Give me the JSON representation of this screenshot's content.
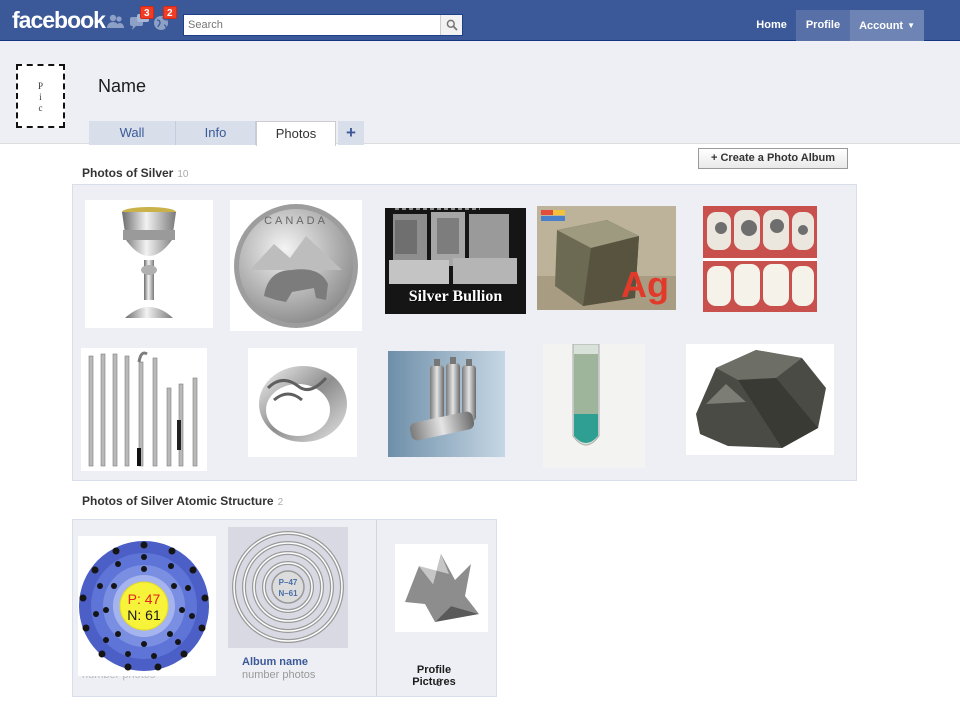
{
  "topbar": {
    "logo": "facebook",
    "search_placeholder": "Search",
    "notifications": [
      {
        "icon": "friend-requests-icon",
        "count": ""
      },
      {
        "icon": "messages-icon",
        "count": "3"
      },
      {
        "icon": "notifications-globe-icon",
        "count": "2"
      }
    ],
    "nav": [
      {
        "label": "Home"
      },
      {
        "label": "Profile"
      },
      {
        "label": "Account"
      }
    ],
    "colors": {
      "bar": "#3b5998",
      "badge": "#f03d25"
    }
  },
  "profile": {
    "pic_letters": [
      "P",
      "i",
      "c"
    ],
    "name": "Name",
    "tabs": [
      {
        "label": "Wall"
      },
      {
        "label": "Info"
      },
      {
        "label": "Photos"
      }
    ],
    "active_tab": "Photos",
    "add_tab_symbol": "+"
  },
  "photos": {
    "create_album_label": "+ Create a Photo Album",
    "album1": {
      "title": "Photos of Silver",
      "count": "10",
      "items": [
        {
          "name": "silver-goblet"
        },
        {
          "name": "canada-silver-coin"
        },
        {
          "name": "silver-bullion-bars",
          "caption": "Silver Bullion"
        },
        {
          "name": "silver-element-cube",
          "caption": "Ag"
        },
        {
          "name": "dental-fillings"
        },
        {
          "name": "silver-flutes"
        },
        {
          "name": "silver-ring"
        },
        {
          "name": "silver-batteries"
        },
        {
          "name": "silver-test-tube"
        },
        {
          "name": "silver-ore-rock"
        }
      ]
    },
    "album2": {
      "title": "Photos of Silver Atomic Structure",
      "count": "2",
      "diagram_p": "P: 47",
      "diagram_n": "N: 61",
      "diagram2_p": "P–47",
      "diagram2_n": "N–61",
      "ghost_sub": "number photos",
      "album_name": "Album name",
      "album_sub": "number photos"
    },
    "profile_pictures": {
      "label": "Profile Pictures",
      "count": "6"
    }
  }
}
